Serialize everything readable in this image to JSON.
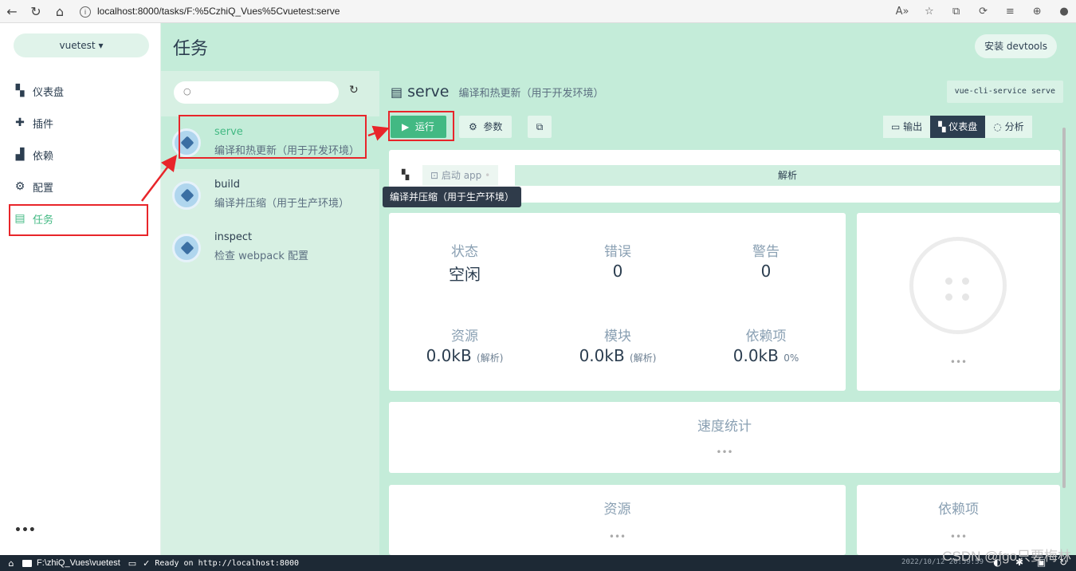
{
  "browser": {
    "url": "localhost:8000/tasks/F:%5CzhiQ_Vues%5Cvuetest:serve",
    "read_aloud": "A»"
  },
  "sidebar": {
    "project": "vuetest",
    "items": [
      {
        "label": "仪表盘",
        "icon": "dashboard-icon"
      },
      {
        "label": "插件",
        "icon": "puzzle-icon"
      },
      {
        "label": "依赖",
        "icon": "library-icon"
      },
      {
        "label": "配置",
        "icon": "settings-icon"
      },
      {
        "label": "任务",
        "icon": "clipboard-icon",
        "active": true
      }
    ],
    "more": "•••"
  },
  "header": {
    "title": "任务",
    "devtools_button": "安装 devtools"
  },
  "tasks": [
    {
      "name": "serve",
      "desc": "编译和热更新（用于开发环境）",
      "selected": true
    },
    {
      "name": "build",
      "desc": "编译并压缩（用于生产环境）"
    },
    {
      "name": "inspect",
      "desc": "检查 webpack 配置"
    }
  ],
  "task_detail": {
    "name": "serve",
    "desc": "编译和热更新（用于开发环境）",
    "command": "vue-cli-service serve",
    "run_label": "运行",
    "params_label": "参数",
    "view_output": "输出",
    "view_dashboard": "仪表盘",
    "view_analyze": "分析",
    "tab_start_app": "启动 app",
    "tab_parse": "解析"
  },
  "tooltip": "编译并压缩（用于生产环境）",
  "stats": {
    "status_label": "状态",
    "status_value": "空闲",
    "errors_label": "错误",
    "errors_value": "0",
    "warnings_label": "警告",
    "warnings_value": "0",
    "assets_label": "资源",
    "assets_value": "0.0kB",
    "assets_suffix": "(解析)",
    "modules_label": "模块",
    "modules_value": "0.0kB",
    "modules_suffix": "(解析)",
    "deps_label": "依赖项",
    "deps_value": "0.0kB",
    "deps_suffix": "0%"
  },
  "donut_more": "•••",
  "speed": {
    "label": "速度统计",
    "more": "•••"
  },
  "assets_panel": {
    "label": "资源",
    "more": "•••"
  },
  "deps_panel": {
    "label": "依赖项",
    "more": "•••"
  },
  "statusbar": {
    "folder": "F:\\zhiQ_Vues\\vuetest",
    "log": "Ready on http://localhost:8000",
    "time": "2022/10/12 20:59:59"
  },
  "watermark": "CSDN @fgo只要梅林",
  "colors": {
    "accent": "#42b983",
    "panel": "#c4ecd9",
    "annotation": "#e8252a"
  }
}
